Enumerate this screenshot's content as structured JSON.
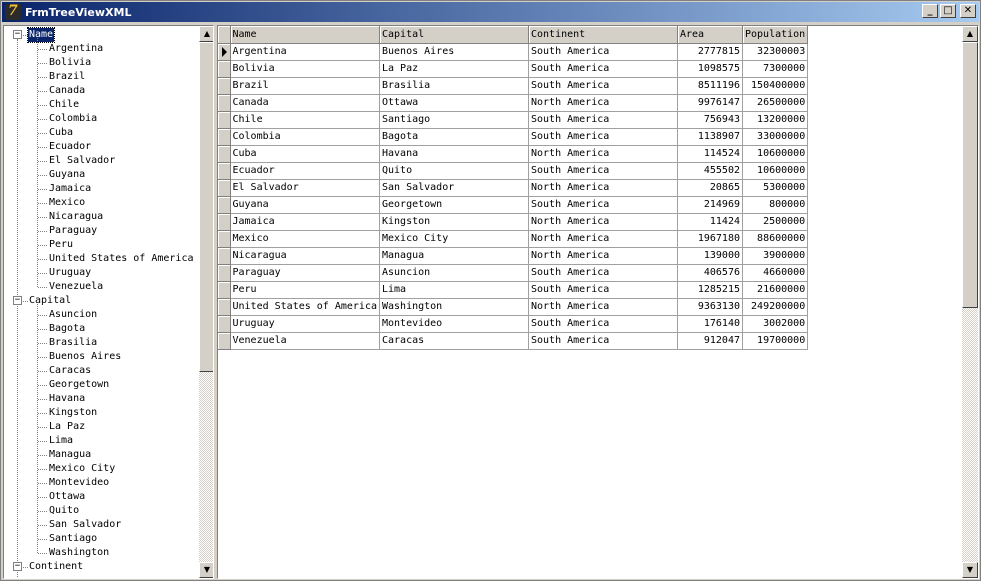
{
  "window": {
    "title": "FrmTreeViewXML",
    "icon": "delphi-app-icon",
    "buttons": {
      "minimize": "_",
      "maximize": "□",
      "close": "✕"
    }
  },
  "tree": {
    "roots": [
      {
        "label": "Name",
        "expanded": true,
        "selected": true,
        "children": [
          "Argentina",
          "Bolivia",
          "Brazil",
          "Canada",
          "Chile",
          "Colombia",
          "Cuba",
          "Ecuador",
          "El Salvador",
          "Guyana",
          "Jamaica",
          "Mexico",
          "Nicaragua",
          "Paraguay",
          "Peru",
          "United States of America",
          "Uruguay",
          "Venezuela"
        ]
      },
      {
        "label": "Capital",
        "expanded": true,
        "selected": false,
        "children": [
          "Asuncion",
          "Bagota",
          "Brasilia",
          "Buenos Aires",
          "Caracas",
          "Georgetown",
          "Havana",
          "Kingston",
          "La Paz",
          "Lima",
          "Managua",
          "Mexico City",
          "Montevideo",
          "Ottawa",
          "Quito",
          "San Salvador",
          "Santiago",
          "Washington"
        ]
      },
      {
        "label": "Continent",
        "expanded": true,
        "selected": false,
        "children": []
      }
    ]
  },
  "grid": {
    "columns": [
      "Name",
      "Capital",
      "Continent",
      "Area",
      "Population"
    ],
    "current_row": 0,
    "rows": [
      [
        "Argentina",
        "Buenos Aires",
        "South America",
        "2777815",
        "32300003"
      ],
      [
        "Bolivia",
        "La Paz",
        "South America",
        "1098575",
        "7300000"
      ],
      [
        "Brazil",
        "Brasilia",
        "South America",
        "8511196",
        "150400000"
      ],
      [
        "Canada",
        "Ottawa",
        "North America",
        "9976147",
        "26500000"
      ],
      [
        "Chile",
        "Santiago",
        "South America",
        "756943",
        "13200000"
      ],
      [
        "Colombia",
        "Bagota",
        "South America",
        "1138907",
        "33000000"
      ],
      [
        "Cuba",
        "Havana",
        "North America",
        "114524",
        "10600000"
      ],
      [
        "Ecuador",
        "Quito",
        "South America",
        "455502",
        "10600000"
      ],
      [
        "El Salvador",
        "San Salvador",
        "North America",
        "20865",
        "5300000"
      ],
      [
        "Guyana",
        "Georgetown",
        "South America",
        "214969",
        "800000"
      ],
      [
        "Jamaica",
        "Kingston",
        "North America",
        "11424",
        "2500000"
      ],
      [
        "Mexico",
        "Mexico City",
        "North America",
        "1967180",
        "88600000"
      ],
      [
        "Nicaragua",
        "Managua",
        "North America",
        "139000",
        "3900000"
      ],
      [
        "Paraguay",
        "Asuncion",
        "South America",
        "406576",
        "4660000"
      ],
      [
        "Peru",
        "Lima",
        "South America",
        "1285215",
        "21600000"
      ],
      [
        "United States of America",
        "Washington",
        "North America",
        "9363130",
        "249200000"
      ],
      [
        "Uruguay",
        "Montevideo",
        "South America",
        "176140",
        "3002000"
      ],
      [
        "Venezuela",
        "Caracas",
        "South America",
        "912047",
        "19700000"
      ]
    ]
  }
}
